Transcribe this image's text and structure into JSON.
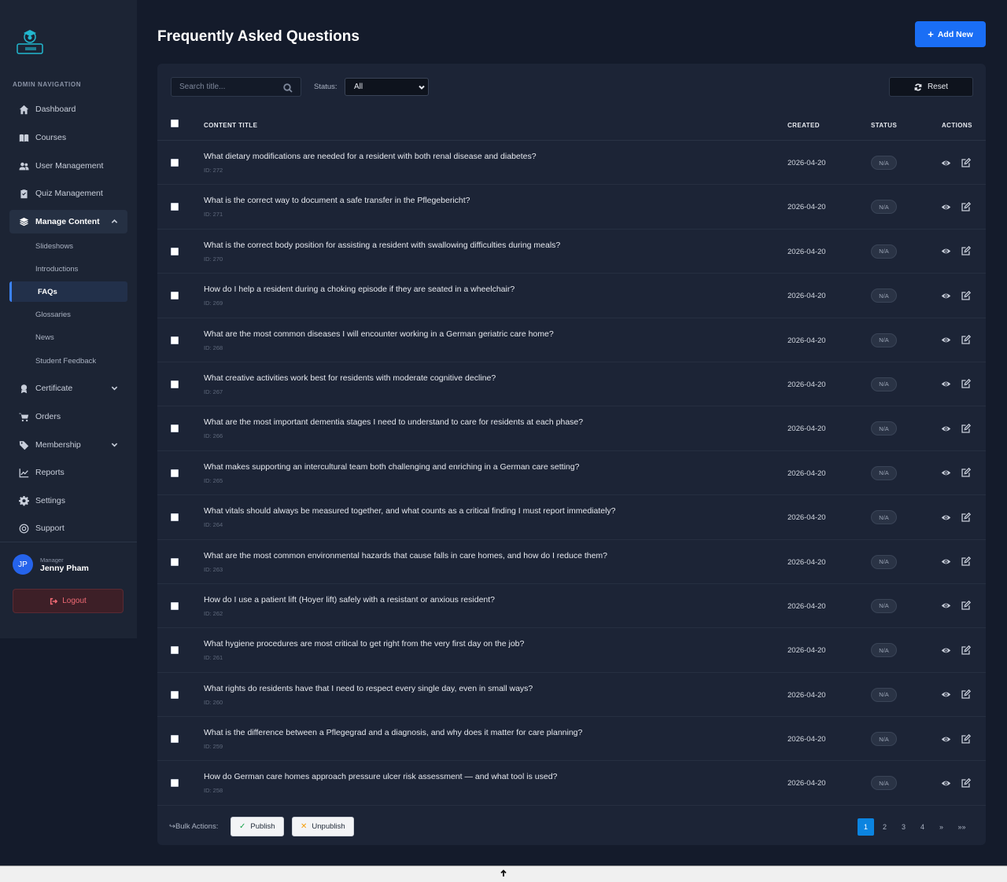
{
  "sidebar": {
    "section_label": "ADMIN NAVIGATION",
    "items": [
      {
        "label": "Dashboard",
        "icon": "home-icon"
      },
      {
        "label": "Courses",
        "icon": "book-icon"
      },
      {
        "label": "User Management",
        "icon": "users-icon"
      },
      {
        "label": "Quiz Management",
        "icon": "clipboard-check-icon"
      },
      {
        "label": "Manage Content",
        "icon": "layers-icon"
      },
      {
        "label": "Certificate",
        "icon": "award-icon"
      },
      {
        "label": "Orders",
        "icon": "cart-icon"
      },
      {
        "label": "Membership",
        "icon": "tag-icon"
      },
      {
        "label": "Reports",
        "icon": "chart-line-icon"
      },
      {
        "label": "Settings",
        "icon": "gear-icon"
      },
      {
        "label": "Support",
        "icon": "help-icon"
      }
    ],
    "sub_items": [
      "Slideshows",
      "Introductions",
      "FAQs",
      "Glossaries",
      "News",
      "Student Feedback"
    ],
    "active_sub_item": "FAQs",
    "user": {
      "initials": "JP",
      "role": "Manager",
      "name": "Jenny Pham"
    },
    "logout_label": "Logout"
  },
  "header": {
    "title": "Frequently Asked Questions",
    "add_new_label": "Add New"
  },
  "filters": {
    "search_placeholder": "Search title...",
    "status_label": "Status:",
    "status_value": "All",
    "reset_label": "Reset"
  },
  "table": {
    "columns": [
      "CONTENT TITLE",
      "CREATED",
      "STATUS",
      "ACTIONS"
    ],
    "rows": [
      {
        "title": "What dietary modifications are needed for a resident with both renal disease and diabetes?",
        "id": "ID: 272",
        "created": "2026-04-20",
        "status": "N/A"
      },
      {
        "title": "What is the correct way to document a safe transfer in the Pflegebericht?",
        "id": "ID: 271",
        "created": "2026-04-20",
        "status": "N/A"
      },
      {
        "title": "What is the correct body position for assisting a resident with swallowing difficulties during meals?",
        "id": "ID: 270",
        "created": "2026-04-20",
        "status": "N/A"
      },
      {
        "title": "How do I help a resident during a choking episode if they are seated in a wheelchair?",
        "id": "ID: 269",
        "created": "2026-04-20",
        "status": "N/A"
      },
      {
        "title": "What are the most common diseases I will encounter working in a German geriatric care home?",
        "id": "ID: 268",
        "created": "2026-04-20",
        "status": "N/A"
      },
      {
        "title": "What creative activities work best for residents with moderate cognitive decline?",
        "id": "ID: 267",
        "created": "2026-04-20",
        "status": "N/A"
      },
      {
        "title": "What are the most important dementia stages I need to understand to care for residents at each phase?",
        "id": "ID: 266",
        "created": "2026-04-20",
        "status": "N/A"
      },
      {
        "title": "What makes supporting an intercultural team both challenging and enriching in a German care setting?",
        "id": "ID: 265",
        "created": "2026-04-20",
        "status": "N/A"
      },
      {
        "title": "What vitals should always be measured together, and what counts as a critical finding I must report immediately?",
        "id": "ID: 264",
        "created": "2026-04-20",
        "status": "N/A"
      },
      {
        "title": "What are the most common environmental hazards that cause falls in care homes, and how do I reduce them?",
        "id": "ID: 263",
        "created": "2026-04-20",
        "status": "N/A"
      },
      {
        "title": "How do I use a patient lift (Hoyer lift) safely with a resistant or anxious resident?",
        "id": "ID: 262",
        "created": "2026-04-20",
        "status": "N/A"
      },
      {
        "title": "What hygiene procedures are most critical to get right from the very first day on the job?",
        "id": "ID: 261",
        "created": "2026-04-20",
        "status": "N/A"
      },
      {
        "title": "What rights do residents have that I need to respect every single day, even in small ways?",
        "id": "ID: 260",
        "created": "2026-04-20",
        "status": "N/A"
      },
      {
        "title": "What is the difference between a Pflegegrad and a diagnosis, and why does it matter for care planning?",
        "id": "ID: 259",
        "created": "2026-04-20",
        "status": "N/A"
      },
      {
        "title": "How do German care homes approach pressure ulcer risk assessment — and what tool is used?",
        "id": "ID: 258",
        "created": "2026-04-20",
        "status": "N/A"
      }
    ]
  },
  "bulk": {
    "label": "Bulk Actions:",
    "publish_label": "Publish",
    "unpublish_label": "Unpublish"
  },
  "pagination": {
    "pages": [
      "1",
      "2",
      "3",
      "4",
      "»",
      "»»"
    ],
    "current": "1"
  },
  "colors": {
    "accent": "#1a6ef5",
    "background": "#141b2b",
    "sidebar": "#1c2434",
    "card": "#1c2436",
    "logout": "#f06a74",
    "pager_active": "#0b84e0"
  }
}
